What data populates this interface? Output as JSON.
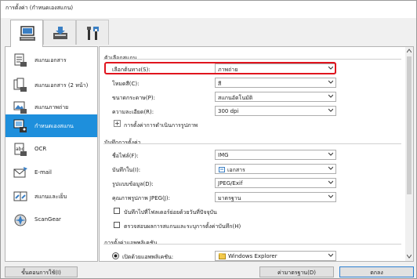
{
  "window": {
    "title": "การตั้งค่า (กำหนดเองสแกน)"
  },
  "top_tabs": [
    {
      "name": "scan-from-computer",
      "active": true
    },
    {
      "name": "scan-from-panel",
      "active": false
    },
    {
      "name": "general-settings",
      "active": false
    }
  ],
  "sidebar": {
    "items": [
      {
        "label": "สแกนเอกสาร",
        "icon": "document-scan-icon"
      },
      {
        "label": "สแกนเอกสาร (2 หน้า)",
        "icon": "two-page-scan-icon"
      },
      {
        "label": "สแกนภาพถ่าย",
        "icon": "photo-scan-icon"
      },
      {
        "label": "กำหนดเองสแกน",
        "icon": "custom-scan-icon",
        "selected": true
      },
      {
        "label": "OCR",
        "icon": "ocr-icon"
      },
      {
        "label": "E-mail",
        "icon": "email-icon"
      },
      {
        "label": "สแกนและเย็บ",
        "icon": "stitch-icon"
      },
      {
        "label": "ScanGear",
        "icon": "scangear-icon"
      }
    ]
  },
  "scan_options": {
    "title": "ตัวเลือกสแกน",
    "select_source": {
      "label": "เลือกต้นทาง(S):",
      "value": "ภาพถ่าย"
    },
    "color_mode": {
      "label": "โหมดสี(C):",
      "value": "สี"
    },
    "paper_size": {
      "label": "ขนาดกระดาษ(P):",
      "value": "สแกนอัตโนมัติ"
    },
    "resolution": {
      "label": "ความละเอียด(R):",
      "value": "300 dpi"
    },
    "image_processing": {
      "label": "การตั้งค่าการดำเนินการรูปภาพ",
      "expand": "+"
    }
  },
  "save_settings": {
    "title": "บันทึกการตั้งค่า",
    "file_name": {
      "label": "ชื่อไฟล์(F):",
      "value": "IMG"
    },
    "save_in": {
      "label": "บันทึกใน(I):",
      "value": "เอกสาร"
    },
    "data_format": {
      "label": "รูปแบบข้อมูล(D):",
      "value": "JPEG/Exif"
    },
    "jpeg_quality": {
      "label": "คุณภาพรูปภาพ JPEG(J):",
      "value": "มาตรฐาน"
    },
    "subfolder_checkbox": {
      "label": "บันทึกไปที่โฟลเดอร์ย่อยด้วยวันที่ปัจจุบัน",
      "checked": false
    },
    "check_results_checkbox": {
      "label": "ตรวจสอบผลการสแกนและระบุการตั้งค่าบันทึก(H)",
      "checked": false
    }
  },
  "app_settings": {
    "title": "การตั้งค่าแอพพลิเคชัน",
    "open_with": {
      "label": "เปิดด้วยแอพพลิเคชัน:",
      "value": "Windows Explorer",
      "selected": true
    }
  },
  "footer": {
    "instructions": "ขั้นตอนการใช้(I)",
    "defaults": "ค่ามาตรฐาน(D)",
    "ok": "ตกลง"
  },
  "colors": {
    "selected_item": "#1e8fdc",
    "highlight_border": "#e0141e",
    "panel_bg": "#f0f0f0"
  }
}
